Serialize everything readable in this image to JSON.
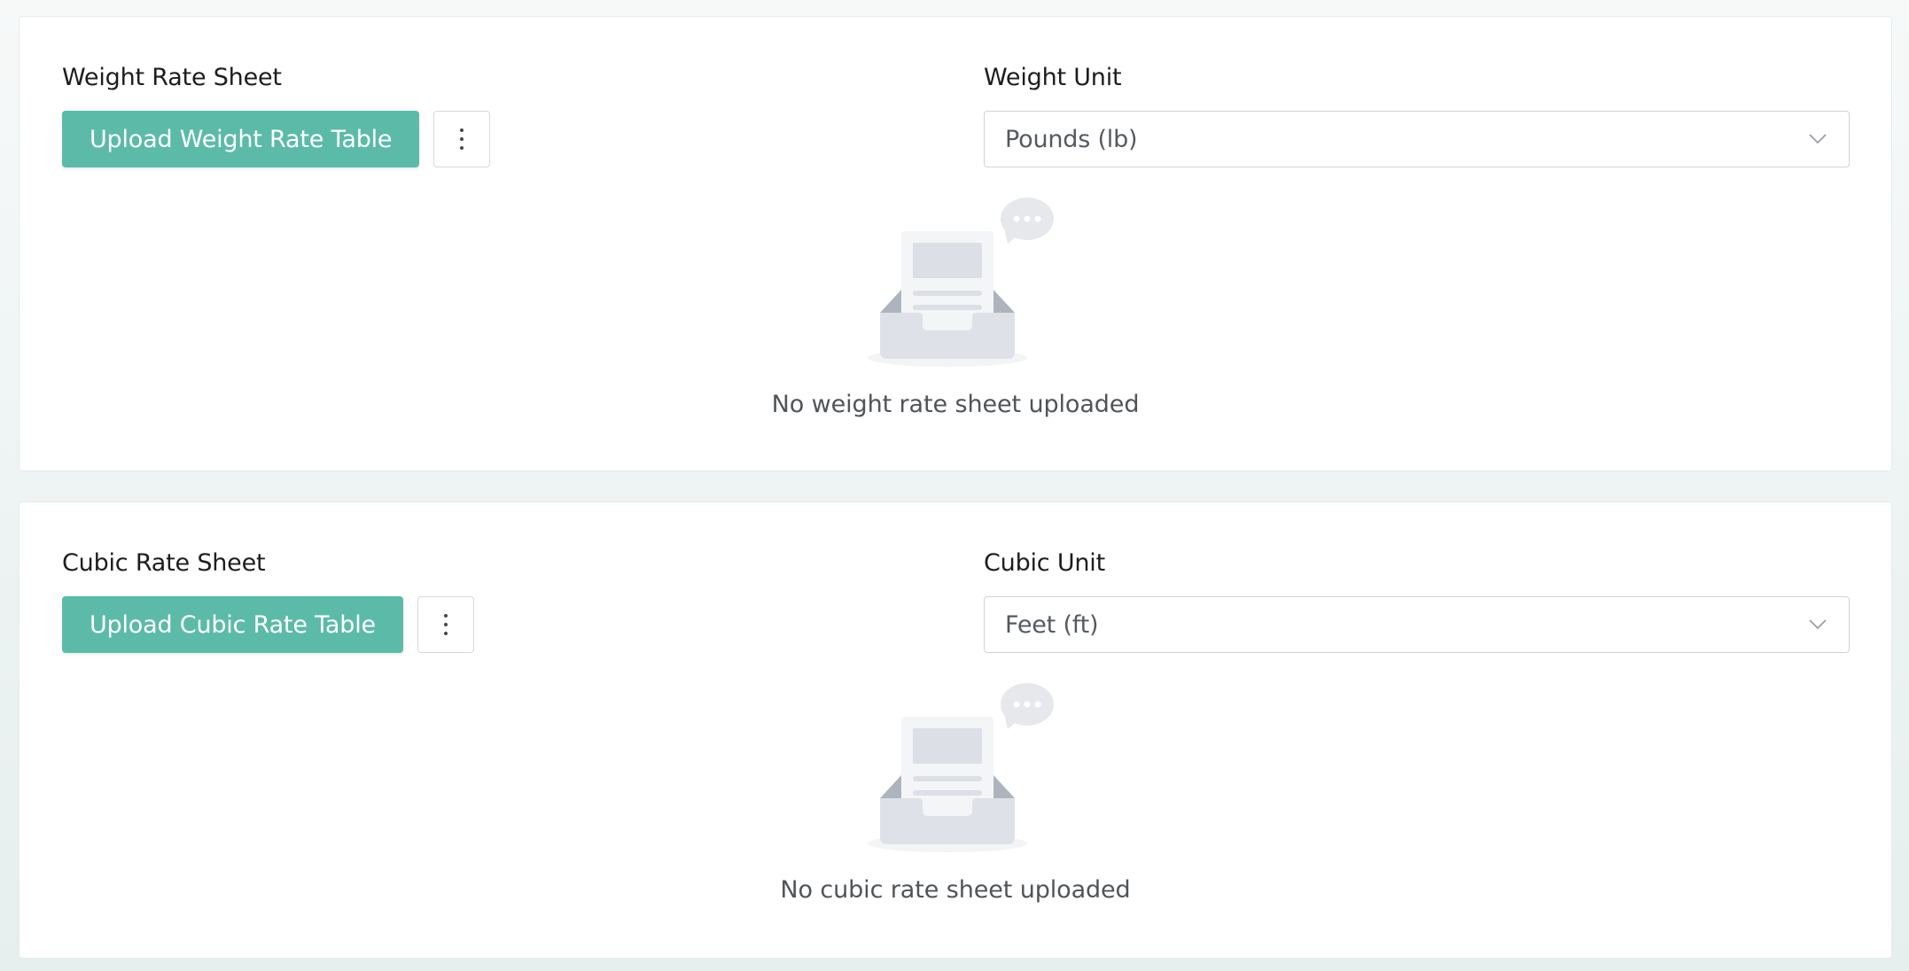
{
  "weight": {
    "section_label": "Weight Rate Sheet",
    "upload_label": "Upload Weight Rate Table",
    "unit_label": "Weight Unit",
    "unit_value": "Pounds (lb)",
    "empty_text": "No weight rate sheet uploaded"
  },
  "cubic": {
    "section_label": "Cubic Rate Sheet",
    "upload_label": "Upload Cubic Rate Table",
    "unit_label": "Cubic Unit",
    "unit_value": "Feet (ft)",
    "empty_text": "No cubic rate sheet uploaded"
  },
  "icons": {
    "more": "more-vertical-icon",
    "dropdown": "chevron-down-icon",
    "empty": "empty-inbox-icon"
  },
  "colors": {
    "accent": "#5bbba8",
    "card_bg": "#ffffff",
    "page_bg": "#edf3f3"
  }
}
